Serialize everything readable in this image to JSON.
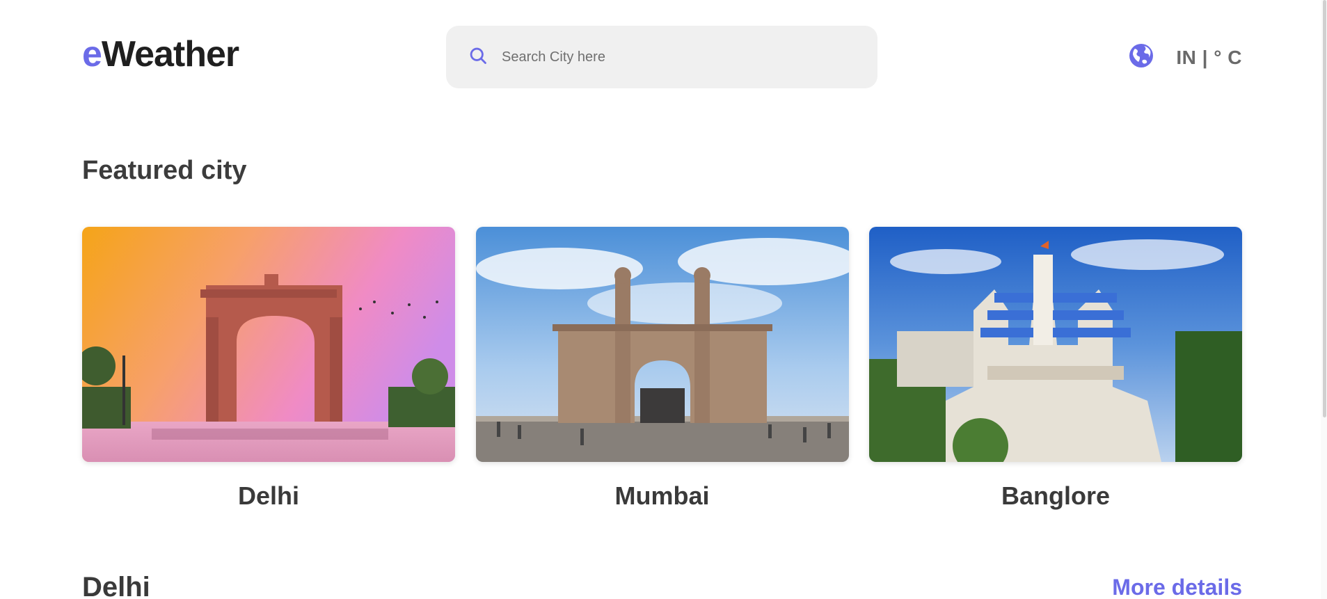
{
  "brand": {
    "prefix": "e",
    "name": "Weather",
    "accent_color": "#6b6be8"
  },
  "search": {
    "placeholder": "Search City here",
    "icon": "search-icon"
  },
  "locale": {
    "icon": "globe-icon",
    "label": "IN | ° C"
  },
  "featured": {
    "title": "Featured city",
    "cities": [
      {
        "name": "Delhi",
        "image": "india-gate-sunset"
      },
      {
        "name": "Mumbai",
        "image": "gateway-of-india"
      },
      {
        "name": "Banglore",
        "image": "iskcon-temple"
      }
    ]
  },
  "details": {
    "city": "Delhi",
    "more_label": "More details"
  }
}
